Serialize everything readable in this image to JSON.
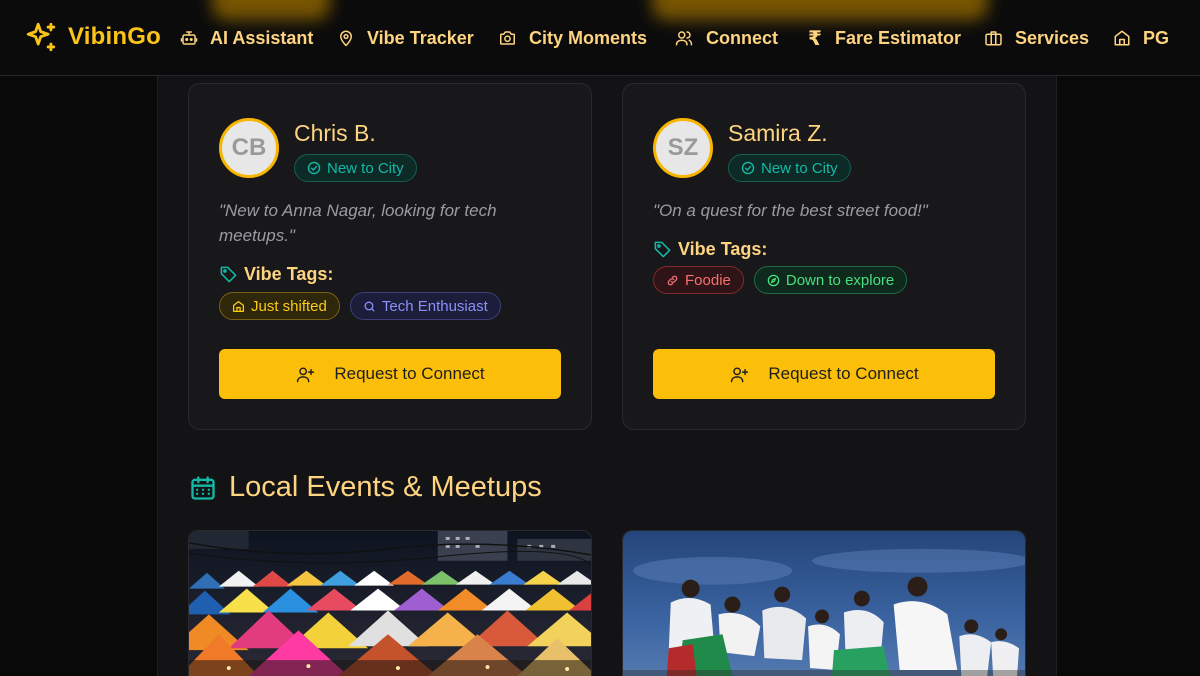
{
  "app": {
    "name": "VibinGo"
  },
  "nav": {
    "items": [
      {
        "label": "AI Assistant",
        "icon": "bot-icon"
      },
      {
        "label": "Vibe Tracker",
        "icon": "map-pin-icon"
      },
      {
        "label": "City Moments",
        "icon": "camera-icon"
      },
      {
        "label": "Connect",
        "icon": "users-icon"
      },
      {
        "label": "Fare Estimator",
        "icon": "rupee-icon"
      },
      {
        "label": "Services",
        "icon": "briefcase-icon"
      },
      {
        "label": "PG",
        "icon": "home-icon"
      }
    ]
  },
  "profiles": [
    {
      "initials": "CB",
      "name": "Chris B.",
      "badge": "New to City",
      "quote": "\"New to Anna Nagar, looking for tech meetups.\"",
      "tags_label": "Vibe Tags:",
      "tags": [
        {
          "label": "Just shifted",
          "icon": "home-icon",
          "color": "#facc15"
        },
        {
          "label": "Tech Enthusiast",
          "icon": "search-icon",
          "color": "#8b8ff8"
        }
      ],
      "button": "Request to Connect"
    },
    {
      "initials": "SZ",
      "name": "Samira Z.",
      "badge": "New to City",
      "quote": "\"On a quest for the best street food!\"",
      "tags_label": "Vibe Tags:",
      "tags": [
        {
          "label": "Foodie",
          "icon": "link-icon",
          "color": "#f87171"
        },
        {
          "label": "Down to explore",
          "icon": "compass-icon",
          "color": "#4ade80"
        }
      ],
      "button": "Request to Connect"
    }
  ],
  "events": {
    "title": "Local Events & Meetups",
    "cards": [
      {
        "image": "night-market-tents-photo"
      },
      {
        "image": "beach-cleanup-volunteers-photo"
      }
    ]
  },
  "colors": {
    "accent": "#fcc419",
    "button": "#fbbf0a",
    "teal": "#14b8a6",
    "background": "#09090a",
    "panel": "#131315"
  }
}
